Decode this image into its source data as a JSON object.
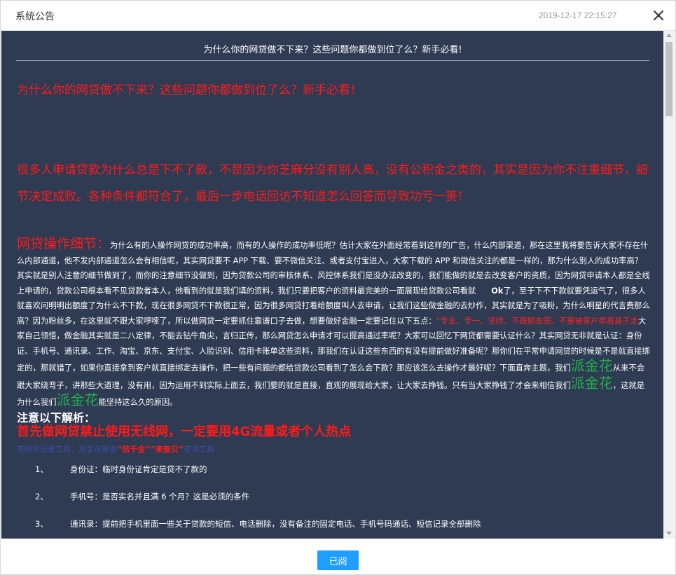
{
  "dialog": {
    "title": "系统公告",
    "timestamp": "2019-12-17 22:15:27"
  },
  "notice": {
    "header_title": "为什么你的网贷做不下来？这些问题你都做到位了么？新手必看!",
    "headline": "为什么你的网贷做不下来？这些问题你都做到位了么？新手必看！",
    "intro": "很多人申请贷款为什么总是下不了款，不是因为你芝麻分没有别人高，没有公积金之类的，其实是因为你不注重细节，细节决定成败。各种条件都符合了，最后一步电话回访不知道怎么回答而导致功亏一篑！",
    "article": {
      "lead": "网贷操作细节：",
      "p1": "为什么有的人操作网贷的成功率高，而有的人操作的成功率低呢？估计大家在外面经常看到这样的广告，什么内部渠道，那在这里我将要告诉大家不存在什么内部通道，他不发内部通道怎么会有相信呢，其实网贷要不 APP 下载、要不微信关注、或者支付宝进入，大家下载的 APP 和微信关注的都是一样的，那为什么别人的成功率高？其实就是别人注意的细节做到了，而你的注意细节没做到，因为贷款公司的审核体系、风控体系我们是没办法改变的，我们能做的就是去改变客户的资质，因为网贷申请本人都是全线上申请的，贷款公司根本看不见贷款者本人，他看到的就是我们填的资料，我们只要把客户的资料最完美的一面展现给贷款公司看就",
      "ok": "Ok",
      "p2": "了，至于下不下款就要凭运气了，很多人就喜欢问明明出额度了为什么不下款，现在很多网贷不下款很正常，因为很多网贷打着给额度叫人去申请，让我们这些做金融的去炒作，其实就是为了吸粉，为什么明星的代言费那么高？因为粉丝多，在这里就不跟大家啰嗦了，所以做网贷一定要抓住靠谱口子去做，想要做好金融一定要记住以下五点：",
      "red_inline": "“专业、专一、坚持、不跟朋友圈、不要被客户牵着鼻子走",
      "p3": "大家自己领悟，做金融其实就是二八定律，不能去钻牛角尖，言归正传，那么网贷怎么申请才可以提高通过率呢？大家可以回忆下网贷都需要认证什么？其实网贷无非就是认证：身份证、手机号、通讯录、工作、淘宝、京东、支付宝、人脸识别、信用卡账单这些资料，那我们在认证这些东西的有没有提前做好准备呢？那你们在平常申请网贷的时候是不是就直接绑定的，那就错了，如果你直接拿到客户就直接绑定去操作，把一些有问题的都给贷款公司看到了怎么会下款？那应该怎么去操作才最好呢？下面直奔主题，我们",
      "brand": "派金花",
      "p4": "从来不会跟大家绕弯子，讲那些大道理，没有用，因为运用不到实际上面去，我们要的就是直接，直观的展现给大家，让大家去挣钱。只有当大家挣钱了才会来相信我们",
      "p5": "，这就是为什么我们",
      "p6": "能坚持这么久的原因。"
    },
    "notes_heading": "注意以下解析：",
    "wifi_heading": "首先做网贷禁止使用无线网，一定要用4G流量或者个人热点",
    "tool_line": {
      "prefix": "查网贷记录工具：派金花里面",
      "highlight": "“信千金”“来查贝”",
      "suffix": "查询工具"
    },
    "list": [
      {
        "num": "1、",
        "text": "身份证：临时身份证肯定是贷不了款的"
      },
      {
        "num": "2、",
        "text": "手机号：是否实名并且满 6 个月？这是必须的条件"
      },
      {
        "num": "3、",
        "text": "通讯录：提前把手机里面一些关于贷款的短信、电话删除，没有备注的固定电话、手机号码通话、短信记录全部删除"
      }
    ]
  },
  "footer": {
    "confirm_label": "已阅"
  },
  "colors": {
    "content_bg": "#2e3b52",
    "accent_red": "#ff1a1a",
    "brand_green": "#22b14c",
    "button_blue": "#1e9fff"
  },
  "icons": {
    "close": "close-icon",
    "scroll_up": "scroll-up-arrow-icon",
    "scroll_down": "scroll-down-arrow-icon"
  }
}
